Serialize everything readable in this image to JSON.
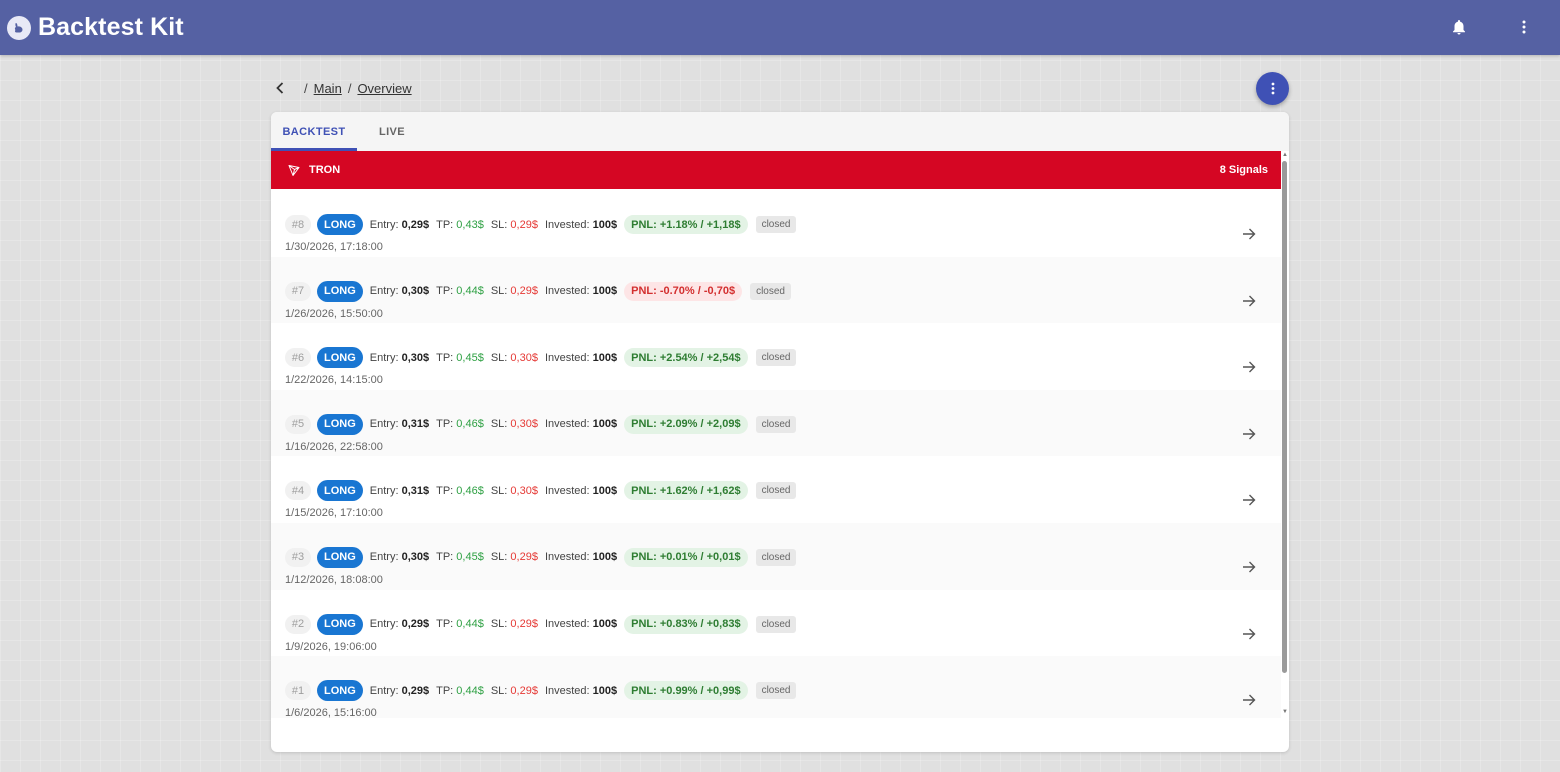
{
  "app": {
    "title": "Backtest Kit"
  },
  "icons": {
    "logo": "rabbit-logo-icon",
    "notifications": "bell-icon",
    "menu": "more-vert-icon",
    "back": "chevron-left-icon",
    "row_action": "arrow-right-icon",
    "coin": "tron-icon"
  },
  "colors": {
    "appbar": "#5561a3",
    "accent": "#3f51b5",
    "banner": "#d50623",
    "long_badge": "#1976d2",
    "positive": "#2e7d32",
    "negative": "#d32f2f"
  },
  "breadcrumb": {
    "items": [
      "Main",
      "Overview"
    ],
    "separator": "/"
  },
  "tabs": [
    {
      "label": "BACKTEST",
      "active": true
    },
    {
      "label": "LIVE",
      "active": false
    }
  ],
  "banner": {
    "symbol": "TRON",
    "signals": "8 Signals"
  },
  "labels": {
    "entry": "Entry:",
    "tp": "TP:",
    "sl": "SL:",
    "invested": "Invested:"
  },
  "signals": [
    {
      "num": "#8",
      "side": "LONG",
      "entry": "0,29$",
      "tp": "0,43$",
      "sl": "0,29$",
      "invested": "100$",
      "pnl": "PNL: +1.18% / +1,18$",
      "pnl_positive": true,
      "status": "closed",
      "date": "1/30/2026, 17:18:00"
    },
    {
      "num": "#7",
      "side": "LONG",
      "entry": "0,30$",
      "tp": "0,44$",
      "sl": "0,29$",
      "invested": "100$",
      "pnl": "PNL: -0.70% / -0,70$",
      "pnl_positive": false,
      "status": "closed",
      "date": "1/26/2026, 15:50:00"
    },
    {
      "num": "#6",
      "side": "LONG",
      "entry": "0,30$",
      "tp": "0,45$",
      "sl": "0,30$",
      "invested": "100$",
      "pnl": "PNL: +2.54% / +2,54$",
      "pnl_positive": true,
      "status": "closed",
      "date": "1/22/2026, 14:15:00"
    },
    {
      "num": "#5",
      "side": "LONG",
      "entry": "0,31$",
      "tp": "0,46$",
      "sl": "0,30$",
      "invested": "100$",
      "pnl": "PNL: +2.09% / +2,09$",
      "pnl_positive": true,
      "status": "closed",
      "date": "1/16/2026, 22:58:00"
    },
    {
      "num": "#4",
      "side": "LONG",
      "entry": "0,31$",
      "tp": "0,46$",
      "sl": "0,30$",
      "invested": "100$",
      "pnl": "PNL: +1.62% / +1,62$",
      "pnl_positive": true,
      "status": "closed",
      "date": "1/15/2026, 17:10:00"
    },
    {
      "num": "#3",
      "side": "LONG",
      "entry": "0,30$",
      "tp": "0,45$",
      "sl": "0,29$",
      "invested": "100$",
      "pnl": "PNL: +0.01% / +0,01$",
      "pnl_positive": true,
      "status": "closed",
      "date": "1/12/2026, 18:08:00"
    },
    {
      "num": "#2",
      "side": "LONG",
      "entry": "0,29$",
      "tp": "0,44$",
      "sl": "0,29$",
      "invested": "100$",
      "pnl": "PNL: +0.83% / +0,83$",
      "pnl_positive": true,
      "status": "closed",
      "date": "1/9/2026, 19:06:00"
    },
    {
      "num": "#1",
      "side": "LONG",
      "entry": "0,29$",
      "tp": "0,44$",
      "sl": "0,29$",
      "invested": "100$",
      "pnl": "PNL: +0.99% / +0,99$",
      "pnl_positive": true,
      "status": "closed",
      "date": "1/6/2026, 15:16:00"
    }
  ]
}
